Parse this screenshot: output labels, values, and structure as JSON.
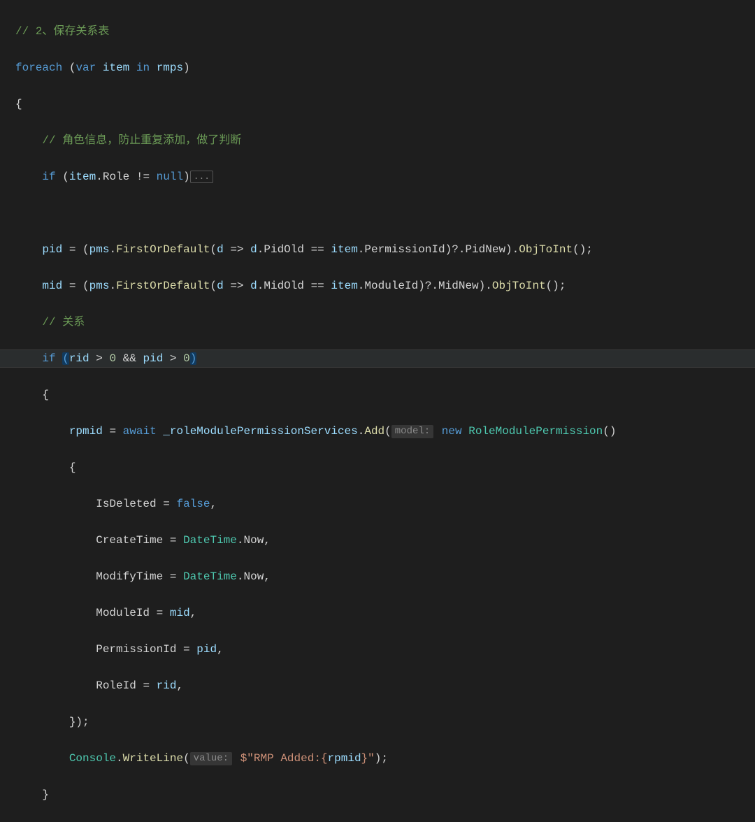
{
  "comments": {
    "saveRelation": "// 2、保存关系表",
    "roleInfo": "// 角色信息，防止重复添加，做了判断",
    "relation": "// 关系"
  },
  "kw": {
    "foreach": "foreach",
    "var": "var",
    "in": "in",
    "if": "if",
    "null": "null",
    "await": "await",
    "new": "new",
    "false": "false"
  },
  "ident": {
    "item": "item",
    "rmps": "rmps",
    "pid": "pid",
    "mid": "mid",
    "pms": "pms",
    "d": "d",
    "rid": "rid",
    "rpmid": "rpmid",
    "roleSvc": "_roleModulePermissionServices"
  },
  "prop": {
    "Role": "Role",
    "PidOld": "PidOld",
    "PermissionId": "PermissionId",
    "PidNew": "PidNew",
    "MidOld": "MidOld",
    "ModuleId": "ModuleId",
    "MidNew": "MidNew",
    "IsDeleted": "IsDeleted",
    "CreateTime": "CreateTime",
    "ModifyTime": "ModifyTime",
    "Now": "Now",
    "RoleId": "RoleId"
  },
  "type": {
    "DateTime": "DateTime",
    "RoleModulePermission": "RoleModulePermission",
    "Console": "Console"
  },
  "method": {
    "FirstOrDefault": "FirstOrDefault",
    "ObjToInt": "ObjToInt",
    "Add": "Add",
    "WriteLine": "WriteLine"
  },
  "num": {
    "zero": "0",
    "amp": "&&",
    "gt": ">"
  },
  "hint": {
    "model": "model:",
    "value": "value:"
  },
  "str": {
    "rmpAdded1": "$\"RMP Added:{",
    "rmpAdded2": "}\""
  },
  "fold": "...",
  "punct": {
    "openParen": "(",
    "closeParen": ")",
    "openBrace": "{",
    "closeBrace": "}",
    "comma": ",",
    "semi": ";",
    "dot": ".",
    "lambda": "=>",
    "eq": "==",
    "neq": "!=",
    "assign": "=",
    "qdot": "?."
  }
}
